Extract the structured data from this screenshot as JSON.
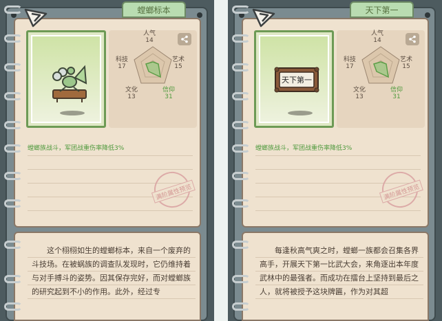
{
  "colors": {
    "accent_green": "#4f9a3d",
    "paper": "#efe2cf",
    "frame": "#7b8b90",
    "stamp": "#cf8a8a"
  },
  "panels": [
    {
      "tab_title": "螳螂标本",
      "stats": {
        "renqi": {
          "label": "人气",
          "value": "14"
        },
        "yishu": {
          "label": "艺术",
          "value": "15"
        },
        "xinyang": {
          "label": "信仰",
          "value": "31"
        },
        "wenhua": {
          "label": "文化",
          "value": "13"
        },
        "keji": {
          "label": "科技",
          "value": "17"
        }
      },
      "effect": "螳螂族战斗，军团战重伤率降低3%",
      "stamp": "满阶属性预览",
      "description": "这个栩栩如生的螳螂标本，来自一个废弃的斗技场。在被蜗族的调查队发现时，它仍维持着与对手搏斗的姿势。因其保存完好，而对螳螂族的研究起到不小的作用。此外，经过专",
      "icons": {
        "logo": "triangle-logo-icon",
        "share": "share-icon",
        "item": "mantis-specimen-icon"
      }
    },
    {
      "tab_title": "天下第一",
      "stats": {
        "renqi": {
          "label": "人气",
          "value": "14"
        },
        "yishu": {
          "label": "艺术",
          "value": "15"
        },
        "xinyang": {
          "label": "信仰",
          "value": "31"
        },
        "wenhua": {
          "label": "文化",
          "value": "13"
        },
        "keji": {
          "label": "科技",
          "value": "17"
        }
      },
      "effect": "螳螂族战斗，军团战重伤率降低3%",
      "stamp": "满阶属性预览",
      "plaque_text": "天下第一",
      "description": "每逢秋高气爽之时，螳螂一族都会召集各界高手，开展天下第一比武大会，来角逐出本年度武林中的最强者。而成功在擂台上坚持到最后之人，就将被授予这块牌匾，作为对其超",
      "icons": {
        "logo": "triangle-logo-icon",
        "share": "share-icon",
        "item": "wooden-plaque-icon"
      }
    }
  ]
}
